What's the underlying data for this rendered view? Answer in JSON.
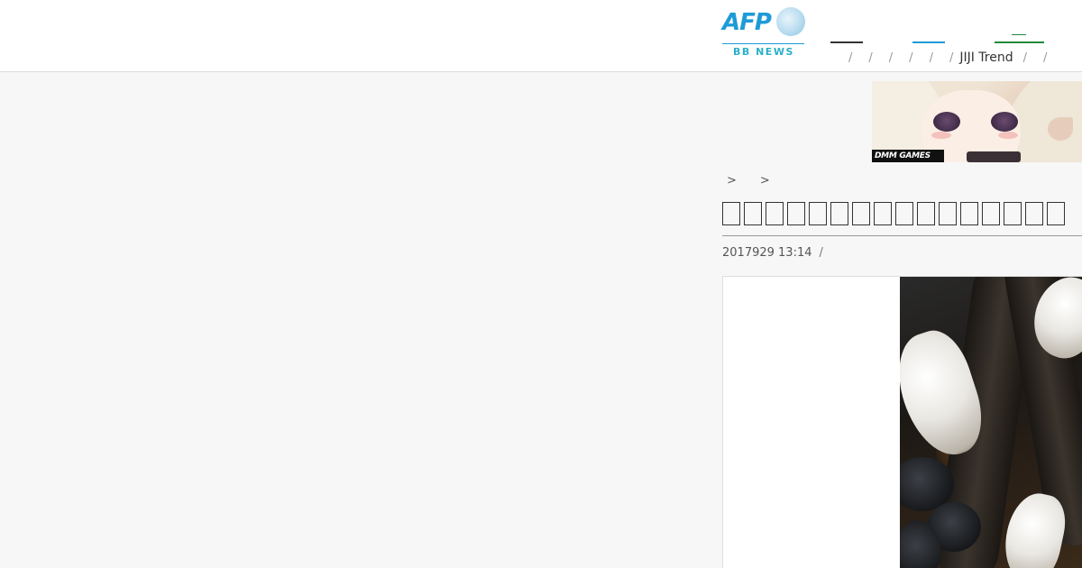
{
  "header": {
    "logo": {
      "brand_text": "AFP",
      "sub_text": "BB NEWS",
      "brand_color": "#1e9bd7",
      "sub_color": "#2bb0c9"
    },
    "nav": {
      "separator": "/",
      "trend_label": "JIJI Trend",
      "accent_colors": [
        "#333333",
        "#1e9bd7",
        "#1e8a3c"
      ]
    }
  },
  "ad_banner": {
    "badge": "DMM GAMES"
  },
  "breadcrumb": {
    "separators": [
      ">",
      ">"
    ]
  },
  "article": {
    "title_glyph_count": 16,
    "date": "2017929 13:14",
    "meta_separator": "/"
  },
  "colors": {
    "page_background": "#f7f7f7",
    "header_background": "#ffffff",
    "title_text": "#222222"
  }
}
